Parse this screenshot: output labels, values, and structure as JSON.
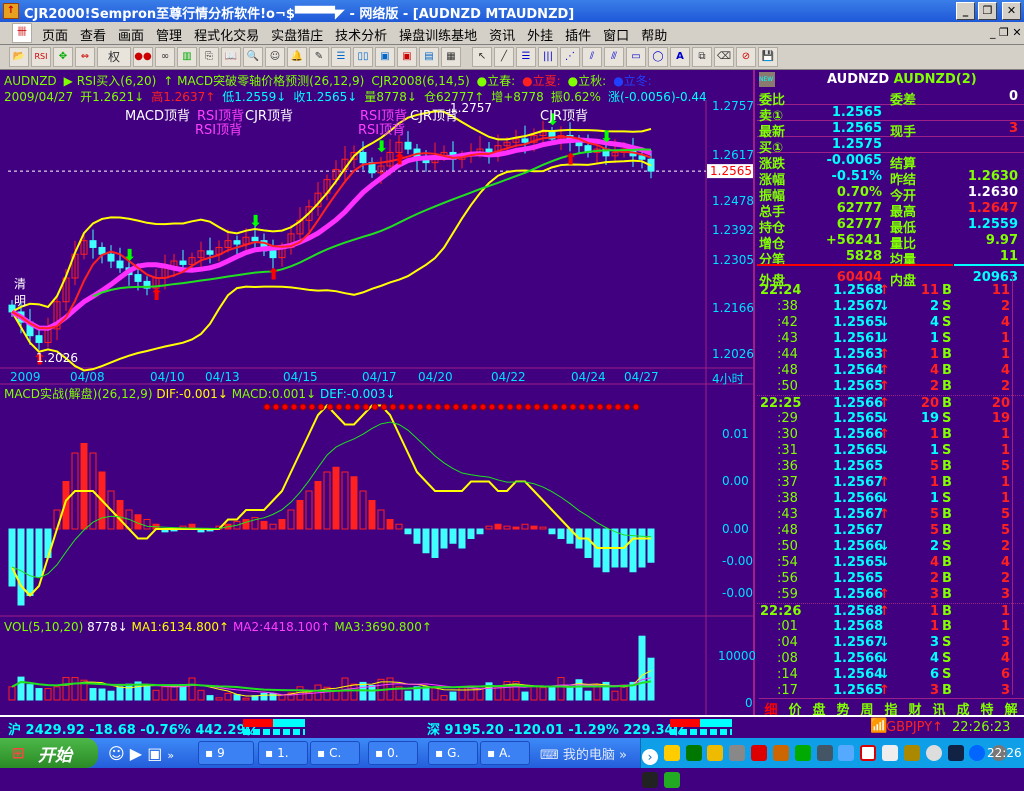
{
  "window": {
    "title": "CJR2000!Sempron至尊行情分析软件!o¬$▀▀▀▀◤ - 网络版 - [AUDNZD MTAUDNZD]",
    "min": "_",
    "max": "❐",
    "close": "✕"
  },
  "menu": [
    "页面",
    "查看",
    "画面",
    "管理",
    "程式化交易",
    "实盘猎庄",
    "技术分析",
    "操盘训练基地",
    "资讯",
    "外挂",
    "插件",
    "窗口",
    "帮助"
  ],
  "toolbar": {
    "rsi": "RSI",
    "quan": "权"
  },
  "header": {
    "line1": [
      {
        "t": "AUDNZD",
        "c": "g"
      },
      {
        "t": "▶ RSI买入(6,20)",
        "c": "g"
      },
      {
        "t": "↑ MACD突破零轴价格预测(26,12,9)",
        "c": "g"
      },
      {
        "t": "CJR2008(6,14,5)",
        "c": "g"
      },
      {
        "t": "●立春:",
        "c": "g"
      },
      {
        "t": "●立夏:",
        "c": "r"
      },
      {
        "t": "●立秋:",
        "c": "g"
      },
      {
        "t": "●立冬:",
        "c": "b"
      }
    ],
    "line2": [
      {
        "t": "2009/04/27",
        "c": "g"
      },
      {
        "t": "开1.2621↓",
        "c": "g"
      },
      {
        "t": "高1.2637↑",
        "c": "r"
      },
      {
        "t": "低1.2559↓",
        "c": "c"
      },
      {
        "t": "收1.2565↓",
        "c": "c"
      },
      {
        "t": "量8778↓",
        "c": "g"
      },
      {
        "t": "仓62777↑",
        "c": "g"
      },
      {
        "t": "增+8778",
        "c": "g"
      },
      {
        "t": "振0.62%",
        "c": "g"
      },
      {
        "t": "涨(-0.0056)-0.44",
        "c": "c"
      }
    ]
  },
  "price_chart": {
    "axis": [
      "1.2757",
      "1.2617",
      "1.2478",
      "1.2392",
      "1.2305",
      "1.2166",
      "1.2026"
    ],
    "current": "1.2565",
    "low_mark": "1.2026",
    "high_mark": "1.2757",
    "annotations": [
      {
        "t": "MACD顶背",
        "c": "w"
      },
      {
        "t": "RSI顶背",
        "c": "m"
      },
      {
        "t": "CJR顶背",
        "c": "w"
      },
      {
        "t": "RSI顶背",
        "c": "m"
      },
      {
        "t": "RSI顶背",
        "c": "m"
      },
      {
        "t": "CJR顶背",
        "c": "w"
      },
      {
        "t": "RSI顶背",
        "c": "m"
      },
      {
        "t": "CJR顶背",
        "c": "w"
      }
    ],
    "holiday": "清明",
    "closes": [
      1.215,
      1.212,
      1.208,
      1.206,
      1.21,
      1.218,
      1.225,
      1.232,
      1.236,
      1.234,
      1.232,
      1.23,
      1.228,
      1.226,
      1.224,
      1.222,
      1.225,
      1.228,
      1.23,
      1.229,
      1.231,
      1.233,
      1.232,
      1.234,
      1.236,
      1.235,
      1.237,
      1.236,
      1.233,
      1.231,
      1.234,
      1.238,
      1.242,
      1.246,
      1.25,
      1.254,
      1.257,
      1.26,
      1.262,
      1.259,
      1.256,
      1.258,
      1.262,
      1.265,
      1.263,
      1.26,
      1.259,
      1.261,
      1.262,
      1.26,
      1.261,
      1.262,
      1.263,
      1.262,
      1.264,
      1.265,
      1.266,
      1.265,
      1.267,
      1.268,
      1.266,
      1.267,
      1.265,
      1.264,
      1.262,
      1.263,
      1.261,
      1.262,
      1.263,
      1.261,
      1.26,
      1.2565
    ]
  },
  "dates": [
    "2009",
    "04/08",
    "04/10",
    "04/13",
    "04/15",
    "04/17",
    "04/20",
    "04/22",
    "04/24",
    "04/27"
  ],
  "period": "4小时",
  "macd": {
    "title": "MACD实战(解盘)(26,12,9)",
    "dif": "DIF:-0.001↓",
    "macd": "MACD:0.001↓",
    "dea": "DEF:-0.003↓",
    "axis": [
      "0.01",
      "0.00",
      "0.00",
      "-0.00",
      "-0.00"
    ],
    "hist": [
      -6,
      -8,
      -7,
      -5,
      -3,
      2,
      5,
      8,
      9,
      8,
      6,
      4,
      3,
      2,
      1.5,
      1,
      0.5,
      -0.3,
      -0.2,
      0.3,
      0.5,
      -0.3,
      -0.2,
      0.3,
      0.5,
      0.8,
      1,
      1.2,
      0.8,
      0.5,
      1,
      2,
      3,
      4,
      5,
      6,
      6.5,
      6,
      5.5,
      4,
      3,
      2,
      1,
      0.5,
      -0.5,
      -1.5,
      -2.5,
      -3,
      -2,
      -1.5,
      -2,
      -1,
      -0.5,
      0.3,
      0.5,
      0.3,
      0.2,
      0.5,
      0.3,
      0.2,
      -0.5,
      -1,
      -1.5,
      -2,
      -3,
      -4,
      -4.5,
      -4,
      -4,
      -4.5,
      -4,
      -3.5
    ],
    "dif_values": [
      -0.004,
      -0.006,
      -0.007,
      -0.006,
      -0.003,
      0.0,
      0.003,
      0.004,
      0.004,
      0.004,
      0.003,
      0.002,
      0.001,
      0.0,
      -0.001,
      -0.001,
      0.0,
      0.0,
      0.0,
      0.0,
      0.0,
      0.0,
      0.0,
      0.0,
      0.001,
      0.001,
      0.002,
      0.002,
      0.002,
      0.003,
      0.004,
      0.006,
      0.008,
      0.01,
      0.012,
      0.013,
      0.012,
      0.011,
      0.011,
      0.012,
      0.013,
      0.013,
      0.012,
      0.01,
      0.008,
      0.006,
      0.005,
      0.004,
      0.004,
      0.004,
      0.004,
      0.005,
      0.005,
      0.005,
      0.004,
      0.004,
      0.005,
      0.005,
      0.004,
      0.003,
      0.002,
      0.001,
      0.0,
      -0.001,
      -0.001,
      -0.002,
      -0.002,
      -0.002,
      -0.002,
      -0.001,
      -0.001,
      -0.001
    ]
  },
  "volume": {
    "title": "VOL(5,10,20)",
    "last": "8778↓",
    "ma1": "MA1:6134.800↑",
    "ma2": "MA2:4418.100↑",
    "ma3": "MA3:3690.800↑",
    "axis": [
      "10000",
      "0"
    ],
    "values": [
      3000,
      5200,
      3500,
      2600,
      2600,
      3000,
      5100,
      5100,
      4500,
      2600,
      2500,
      2000,
      3000,
      3600,
      4100,
      3500,
      2200,
      3000,
      3000,
      3500,
      5000,
      2200,
      1000,
      500,
      1500,
      1200,
      400,
      1000,
      1500,
      1500,
      1200,
      1600,
      3000,
      1800,
      3400,
      2900,
      2200,
      5000,
      3600,
      4000,
      3300,
      4700,
      5000,
      3000,
      2000,
      3000,
      3000,
      2700,
      1000,
      1800,
      2800,
      3200,
      3000,
      3900,
      3000,
      4200,
      4200,
      1800,
      3000,
      2800,
      3000,
      5100,
      3100,
      4600,
      2000,
      3400,
      4000,
      2000,
      3400,
      4000,
      14500,
      9500
    ]
  },
  "quote": {
    "symbol": "AUDNZD",
    "name": "AUDNZD(2)",
    "new_icon": "NEW",
    "rows": [
      {
        "l": "委比",
        "v": "",
        "l2": "委差",
        "v2": "0",
        "vc": "c",
        "v2c": "w"
      },
      {
        "l": "卖①",
        "v": "1.2565",
        "l2": "",
        "v2": "",
        "vc": "c",
        "v2c": "w"
      },
      {
        "l": "最新",
        "v": "1.2565",
        "l2": "现手",
        "v2": "3",
        "vc": "c",
        "v2c": "r"
      },
      {
        "l": "买①",
        "v": "1.2575",
        "l2": "",
        "v2": "",
        "vc": "c",
        "v2c": "w"
      },
      {
        "l": "涨跌",
        "v": "-0.0065",
        "l2": "结算",
        "v2": "",
        "vc": "c",
        "v2c": "w"
      },
      {
        "l": "涨幅",
        "v": "-0.51%",
        "l2": "昨结",
        "v2": "1.2630",
        "vc": "c",
        "v2c": "g"
      },
      {
        "l": "振幅",
        "v": "0.70%",
        "l2": "今开",
        "v2": "1.2630",
        "vc": "g",
        "v2c": "w"
      },
      {
        "l": "总手",
        "v": "62777",
        "l2": "最高",
        "v2": "1.2647",
        "vc": "g",
        "v2c": "r"
      },
      {
        "l": "持仓",
        "v": "62777",
        "l2": "最低",
        "v2": "1.2559",
        "vc": "g",
        "v2c": "c"
      },
      {
        "l": "增仓",
        "v": "+56241",
        "l2": "量比",
        "v2": "9.97",
        "vc": "g",
        "v2c": "g"
      },
      {
        "l": "分笔",
        "v": "5828",
        "l2": "均量",
        "v2": "11",
        "vc": "g",
        "v2c": "g"
      },
      {
        "l": "外盘",
        "v": "60404",
        "l2": "内盘",
        "v2": "20963",
        "vc": "r",
        "v2c": "c"
      }
    ],
    "ticks": [
      [
        "22:24",
        "1.2568",
        "↑",
        "11",
        "B",
        "11"
      ],
      [
        ":38",
        "1.2567",
        "↓",
        "2",
        "S",
        "2"
      ],
      [
        ":42",
        "1.2565",
        "↓",
        "4",
        "S",
        "4"
      ],
      [
        ":43",
        "1.2561",
        "↓",
        "1",
        "S",
        "1"
      ],
      [
        ":44",
        "1.2563",
        "↑",
        "1",
        "B",
        "1"
      ],
      [
        ":48",
        "1.2564",
        "↑",
        "4",
        "B",
        "4"
      ],
      [
        ":50",
        "1.2565",
        "↑",
        "2",
        "B",
        "2"
      ],
      [
        "22:25",
        "1.2566",
        "↑",
        "20",
        "B",
        "20"
      ],
      [
        ":29",
        "1.2565",
        "↓",
        "19",
        "S",
        "19"
      ],
      [
        ":30",
        "1.2566",
        "↑",
        "1",
        "B",
        "1"
      ],
      [
        ":31",
        "1.2565",
        "↓",
        "1",
        "S",
        "1"
      ],
      [
        ":36",
        "1.2565",
        "",
        "5",
        "B",
        "5"
      ],
      [
        ":37",
        "1.2567",
        "↑",
        "1",
        "B",
        "1"
      ],
      [
        ":38",
        "1.2566",
        "↓",
        "1",
        "S",
        "1"
      ],
      [
        ":43",
        "1.2567",
        "↑",
        "5",
        "B",
        "5"
      ],
      [
        ":48",
        "1.2567",
        "",
        "5",
        "B",
        "5"
      ],
      [
        ":50",
        "1.2566",
        "↓",
        "2",
        "S",
        "2"
      ],
      [
        ":54",
        "1.2565",
        "↓",
        "4",
        "B",
        "4"
      ],
      [
        ":56",
        "1.2565",
        "",
        "2",
        "B",
        "2"
      ],
      [
        ":59",
        "1.2566",
        "↑",
        "3",
        "B",
        "3"
      ],
      [
        "22:26",
        "1.2568",
        "↑",
        "1",
        "B",
        "1"
      ],
      [
        ":01",
        "1.2568",
        "",
        "1",
        "B",
        "1"
      ],
      [
        ":04",
        "1.2567",
        "↓",
        "3",
        "S",
        "3"
      ],
      [
        ":08",
        "1.2566",
        "↓",
        "4",
        "S",
        "4"
      ],
      [
        ":14",
        "1.2564",
        "↓",
        "6",
        "S",
        "6"
      ],
      [
        ":17",
        "1.2565",
        "↑",
        "3",
        "B",
        "3"
      ]
    ],
    "tabs": [
      "细",
      "价",
      "盘",
      "势",
      "周",
      "指",
      "财",
      "讯",
      "成",
      "特",
      "解"
    ]
  },
  "status": {
    "sh": "沪 2429.92 -18.68 -0.76% 442.29亿",
    "sz": "深 9195.20 -120.01 -1.29% 229.34亿",
    "ticker": "GBPJPY↑",
    "time": "22:26:23"
  },
  "taskbar": {
    "start": "开始",
    "tasks": [
      "9",
      "1.",
      "C.",
      "0.",
      "G.",
      "A."
    ],
    "mycomputer": "我的电脑",
    "clock": "22:26"
  }
}
